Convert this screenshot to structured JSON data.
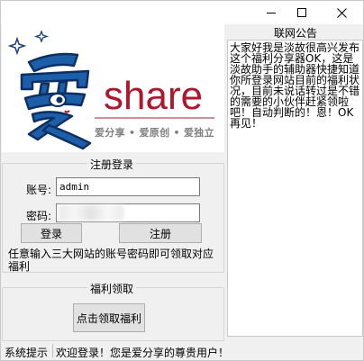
{
  "window": {
    "controls": {
      "minimize": "minimize",
      "maximize": "maximize",
      "close": "close"
    }
  },
  "logo": {
    "glyph": "爱",
    "wordmark": "share",
    "slogan": "爱分享 • 爱原创 • 爱独立"
  },
  "register": {
    "title": "注册登录",
    "account_label": "账号:",
    "account_value": "admin",
    "password_label": "密码:",
    "login_button": "登录",
    "register_button": "注册",
    "hint": "任意输入三大网站的账号密码即可领取对应福利"
  },
  "welfare": {
    "title": "福利领取",
    "claim_button": "点击领取福利"
  },
  "announcement": {
    "title": "联网公告",
    "content": "大家好我是淡故很高兴发布这个福利分享器OK，这是淡故助手的辅助器快捷知道你所登录网站目前的福利状况，目前未说话转过是不错的需要的小伙伴赶紧领啦吧！自动判断的！恩！OK再见！"
  },
  "status": {
    "label": "系统提示",
    "message": "欢迎登录！您是爱分享的尊贵用户！"
  },
  "colors": {
    "brand_blue": "#1c5ea8",
    "brand_red": "#b0172d",
    "window_bg": "#f0f0f0"
  }
}
